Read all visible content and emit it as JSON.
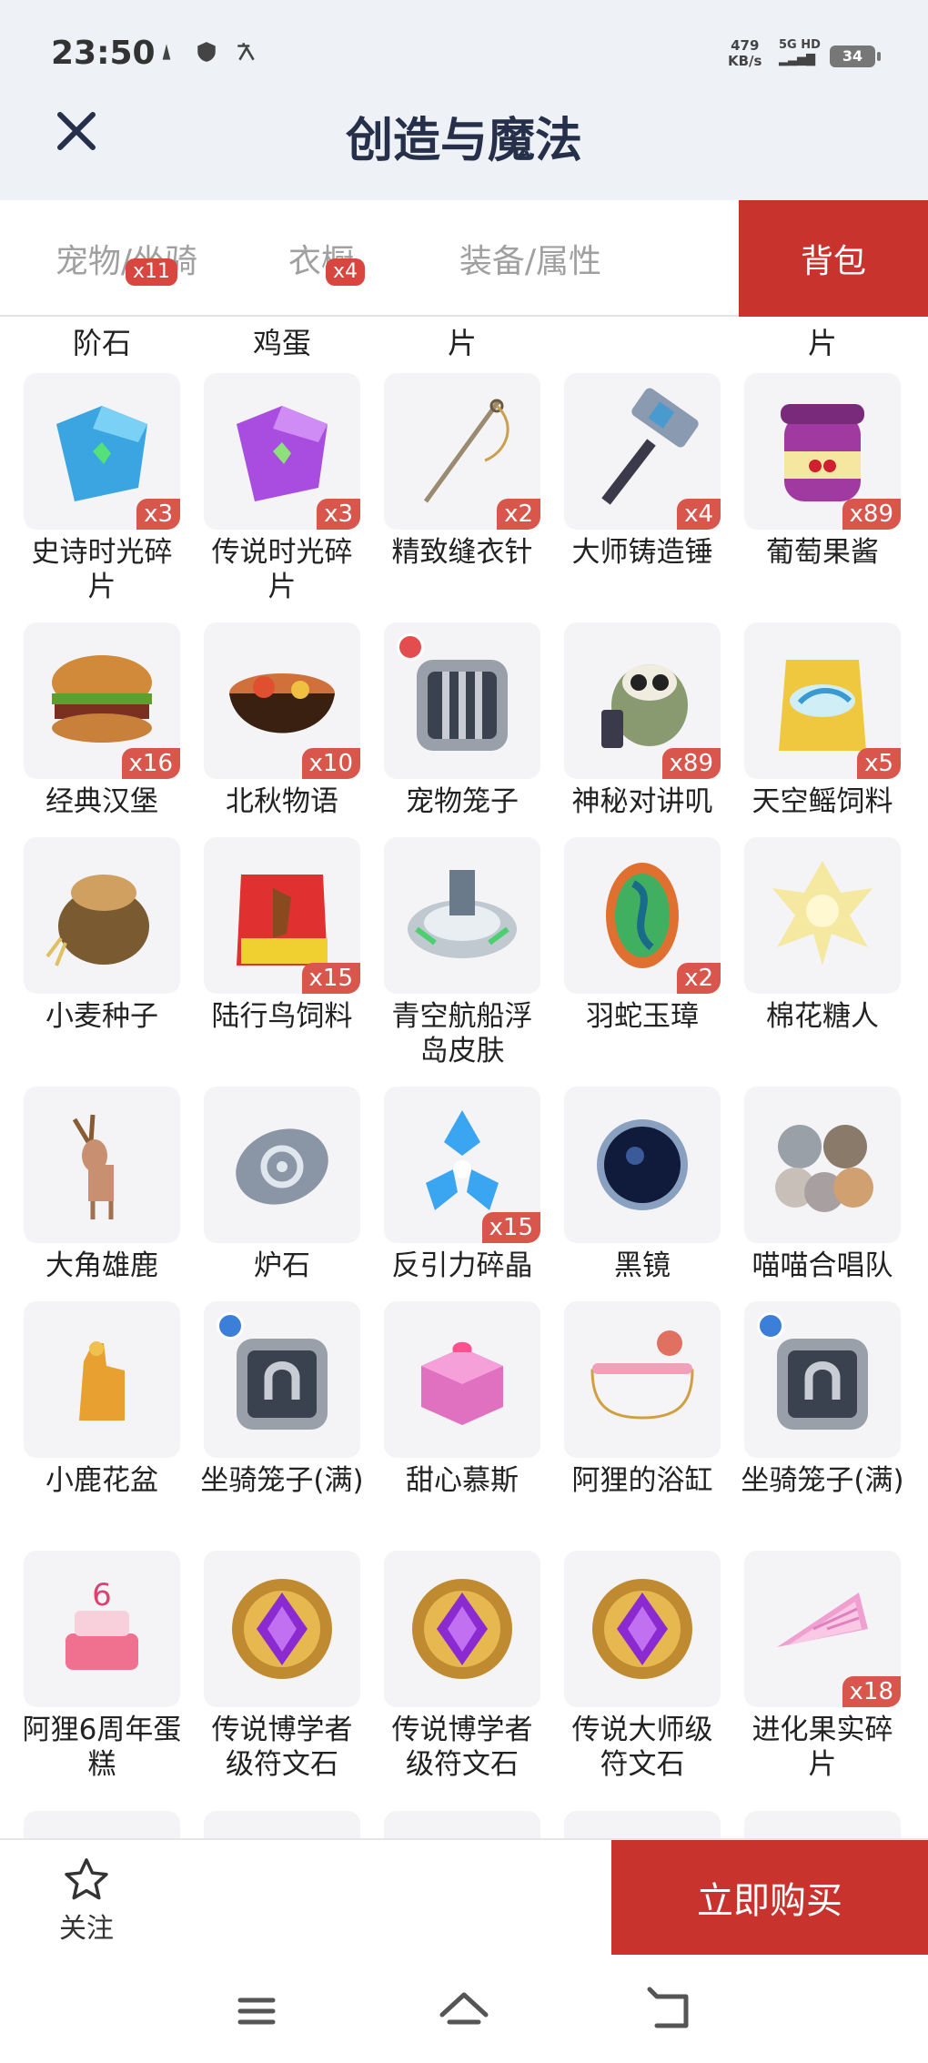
{
  "status": {
    "time": "23:50",
    "net_speed": "479",
    "net_unit": "KB/s",
    "signal": "5G HD",
    "battery": "34"
  },
  "header": {
    "title": "创造与魔法"
  },
  "tabs": [
    {
      "label": "宠物/坐骑",
      "badge": "x11"
    },
    {
      "label": "衣橱",
      "badge": "x4"
    },
    {
      "label": "装备/属性",
      "badge": ""
    },
    {
      "label": "背包",
      "badge": ""
    }
  ],
  "partial_row": [
    "阶石",
    "鸡蛋",
    "片",
    "",
    "片"
  ],
  "items": [
    {
      "name": "史诗时光碎片",
      "qty": "x3",
      "icon": "blue-puzzle-icon"
    },
    {
      "name": "传说时光碎片",
      "qty": "x3",
      "icon": "purple-puzzle-icon"
    },
    {
      "name": "精致缝衣针",
      "qty": "x2",
      "icon": "needle-icon"
    },
    {
      "name": "大师铸造锤",
      "qty": "x4",
      "icon": "hammer-icon"
    },
    {
      "name": "葡萄果酱",
      "qty": "x89",
      "icon": "jam-jar-icon"
    },
    {
      "name": "经典汉堡",
      "qty": "x16",
      "icon": "burger-icon"
    },
    {
      "name": "北秋物语",
      "qty": "x10",
      "icon": "bowl-icon"
    },
    {
      "name": "宠物笼子",
      "qty": "",
      "icon": "pet-cage-icon"
    },
    {
      "name": "神秘对讲叽",
      "qty": "x89",
      "icon": "bird-walkie-icon"
    },
    {
      "name": "天空鳐饲料",
      "qty": "x5",
      "icon": "feed-bag-icon"
    },
    {
      "name": "小麦种子",
      "qty": "",
      "icon": "seed-sack-icon"
    },
    {
      "name": "陆行鸟饲料",
      "qty": "x15",
      "icon": "bird-feed-icon"
    },
    {
      "name": "青空航船浮岛皮肤",
      "qty": "",
      "icon": "island-icon"
    },
    {
      "name": "羽蛇玉璋",
      "qty": "x2",
      "icon": "jade-icon"
    },
    {
      "name": "棉花糖人",
      "qty": "",
      "icon": "cotton-creature-icon"
    },
    {
      "name": "大角雄鹿",
      "qty": "",
      "icon": "deer-icon"
    },
    {
      "name": "炉石",
      "qty": "",
      "icon": "hearthstone-icon"
    },
    {
      "name": "反引力碎晶",
      "qty": "x15",
      "icon": "crystal-icon"
    },
    {
      "name": "黑镜",
      "qty": "",
      "icon": "black-mirror-icon"
    },
    {
      "name": "喵喵合唱队",
      "qty": "",
      "icon": "cats-icon"
    },
    {
      "name": "小鹿花盆",
      "qty": "",
      "icon": "flowerpot-icon"
    },
    {
      "name": "坐骑笼子(满)",
      "qty": "",
      "icon": "mount-cage-icon"
    },
    {
      "name": "甜心慕斯",
      "qty": "",
      "icon": "mousse-icon"
    },
    {
      "name": "阿狸的浴缸",
      "qty": "",
      "icon": "bathtub-icon"
    },
    {
      "name": "坐骑笼子(满)",
      "qty": "",
      "icon": "mount-cage-icon"
    },
    {
      "name": "阿狸6周年蛋糕",
      "qty": "",
      "icon": "cake-icon"
    },
    {
      "name": "传说博学者级符文石",
      "qty": "",
      "icon": "rune-icon"
    },
    {
      "name": "传说博学者级符文石",
      "qty": "",
      "icon": "rune-icon"
    },
    {
      "name": "传说大师级符文石",
      "qty": "",
      "icon": "rune-icon"
    },
    {
      "name": "进化果实碎片",
      "qty": "x18",
      "icon": "fruit-shard-icon"
    }
  ],
  "bottom": {
    "follow_label": "关注",
    "buy_label": "立即购买"
  },
  "colors": {
    "accent": "#c9332e",
    "badge": "#d9564d",
    "title": "#26304a"
  }
}
